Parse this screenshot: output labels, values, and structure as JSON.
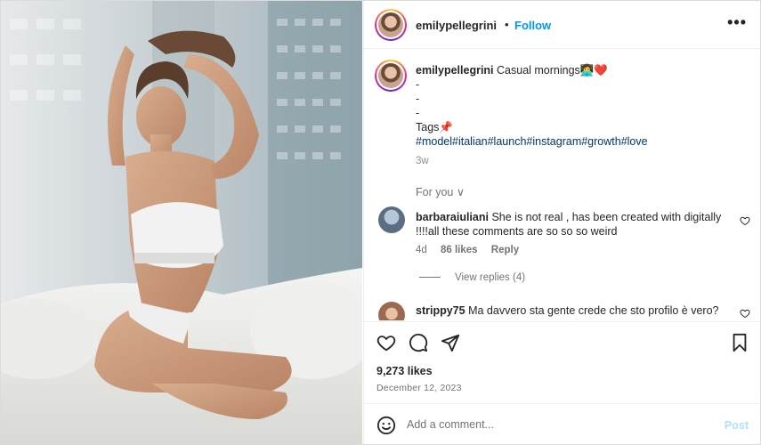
{
  "post": {
    "username": "emilypellegrini",
    "separator": "•",
    "follow_label": "Follow",
    "more_label": "•••"
  },
  "caption": {
    "username": "emilypellegrini",
    "text": "Casual mornings👩‍💻❤️",
    "dash1": "-",
    "dash2": "-",
    "dash3": "-",
    "tags_label": "Tags📌",
    "hashtags": "#model#italian#launch#instagram#growth#love",
    "time": "3w"
  },
  "for_you": "For you ∨",
  "comments": [
    {
      "username": "barbaraiuliani",
      "text": "She is not real , has been created with digitally !!!!all these comments are so so so weird",
      "time": "4d",
      "likes": "86 likes",
      "reply": "Reply",
      "view_replies": "View replies (4)"
    },
    {
      "username": "strippy75",
      "text": "Ma davvero sta gente crede che sto profilo è vero?"
    }
  ],
  "likes_count": "9,273 likes",
  "date": "December 12, 2023",
  "add_comment": {
    "placeholder": "Add a comment...",
    "post_label": "Post"
  },
  "icons": [
    "heart-icon",
    "comment-icon",
    "share-icon",
    "bookmark-icon",
    "emoji-icon",
    "more-icon"
  ],
  "colors": {
    "accent": "#0095f6",
    "hashtag": "#00376b",
    "muted": "#737373",
    "post_disabled": "#b2dffc"
  }
}
